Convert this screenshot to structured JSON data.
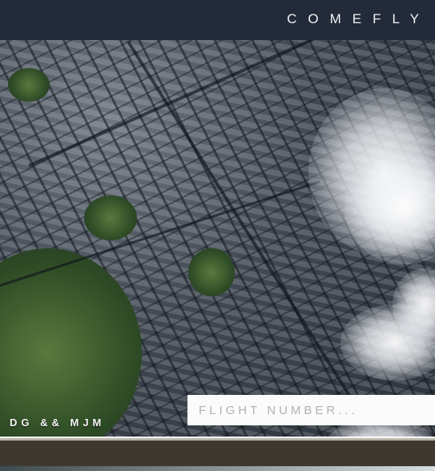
{
  "header": {
    "brand": "COMEFLY"
  },
  "map": {
    "description_icon": "aerial-map-icon"
  },
  "footer": {
    "credit": "DG && MJM"
  },
  "search": {
    "placeholder": "FLIGHT NUMBER..."
  },
  "colors": {
    "header_bg": "#232a39",
    "footer_bg": "#3d3931",
    "input_bg": "#fbfbfb"
  }
}
